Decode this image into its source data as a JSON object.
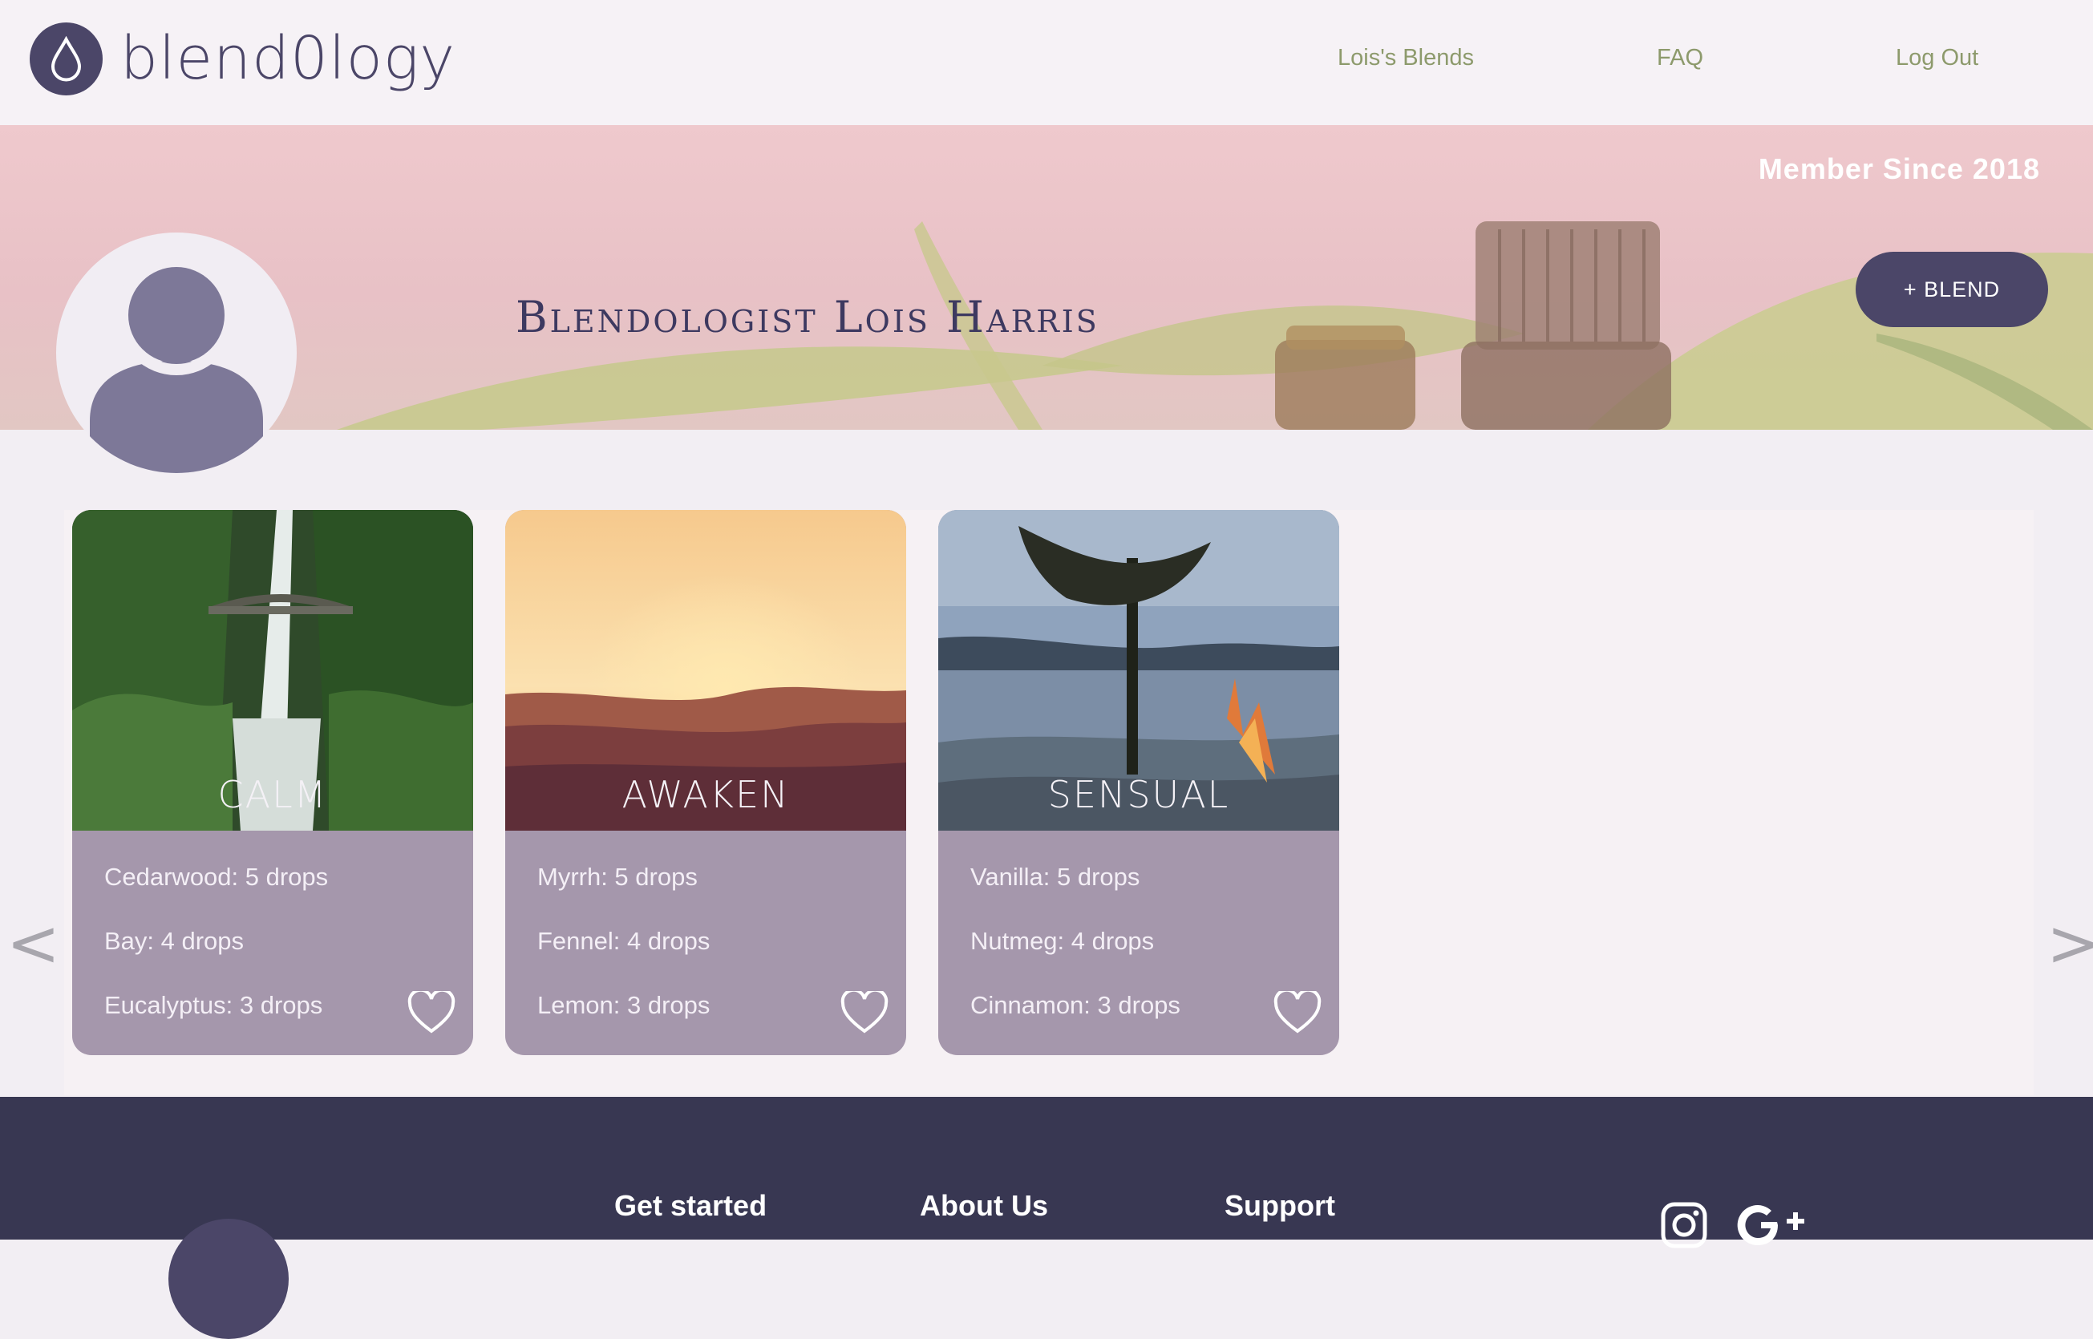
{
  "header": {
    "logo_text": "blend0logy",
    "nav": [
      {
        "label": "Lois's Blends"
      },
      {
        "label": "FAQ"
      },
      {
        "label": "Log Out"
      }
    ]
  },
  "profile": {
    "member_since": "Member Since 2018",
    "name": "Blendologist Lois Harris",
    "blend_button": "+ BLEND"
  },
  "carousel": {
    "prev": "<",
    "next": ">",
    "cards": [
      {
        "title": "CALM",
        "ingredients": [
          "Cedarwood: 5 drops",
          "Bay: 4 drops",
          "Eucalyptus: 3 drops"
        ]
      },
      {
        "title": "AWAKEN",
        "ingredients": [
          "Myrrh: 5 drops",
          "Fennel: 4 drops",
          "Lemon: 3 drops"
        ]
      },
      {
        "title": "SENSUAL",
        "ingredients": [
          "Vanilla: 5 drops",
          "Nutmeg: 4 drops",
          "Cinnamon: 3 drops"
        ]
      }
    ]
  },
  "footer": {
    "links": [
      "Get started",
      "About Us",
      "Support"
    ],
    "social": [
      "instagram-icon",
      "google-plus-icon"
    ]
  },
  "colors": {
    "brand": "#4b4668",
    "nav_link": "#8d9a6c",
    "card": "#a597ac",
    "footer": "#383752"
  }
}
